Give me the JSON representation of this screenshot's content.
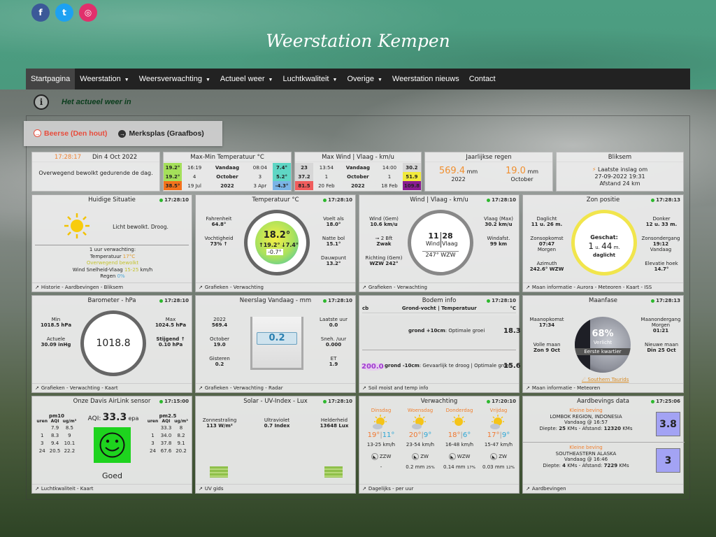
{
  "site_title": "Weerstation Kempen",
  "social": [
    {
      "name": "facebook-icon",
      "glyph": "f",
      "color": "#3b5998"
    },
    {
      "name": "twitter-icon",
      "glyph": "t",
      "color": "#1da1f2"
    },
    {
      "name": "instagram-icon",
      "glyph": "◎",
      "color": "#e1306c"
    }
  ],
  "nav": [
    {
      "label": "Startpagina",
      "caret": false
    },
    {
      "label": "Weerstation",
      "caret": true
    },
    {
      "label": "Weersverwachting",
      "caret": true
    },
    {
      "label": "Actueel weer",
      "caret": true
    },
    {
      "label": "Luchtkwaliteit",
      "caret": true
    },
    {
      "label": "Overige",
      "caret": true
    },
    {
      "label": "Weerstation nieuws",
      "caret": false
    },
    {
      "label": "Contact",
      "caret": false
    }
  ],
  "info_label": "Het actueel weer in",
  "locations": [
    "Beerse (Den hout)",
    "Merksplas (Graafbos)"
  ],
  "current": {
    "time": "17:28:17",
    "date": "Din 4 Oct 2022",
    "text": "Overwegend bewolkt gedurende de dag."
  },
  "maxmin": {
    "title": "Max-Min Temperatuur °C",
    "rows": [
      {
        "a": "19.2°",
        "ac": "#a4e05a",
        "at": "16:19",
        "label": "Vandaag",
        "bt": "08:04",
        "b": "7.4°",
        "bc": "#5fd6c4"
      },
      {
        "a": "19.2°",
        "ac": "#a4e05a",
        "at": "4",
        "label": "October",
        "bt": "3",
        "b": "5.2°",
        "bc": "#5fd6c4"
      },
      {
        "a": "38.5°",
        "ac": "#f4721c",
        "at": "19 Jul",
        "label": "2022",
        "bt": "3 Apr",
        "b": "-4.3°",
        "bc": "#7ab4e6"
      }
    ]
  },
  "maxwind": {
    "title": "Max Wind | Vlaag - km/u",
    "rows": [
      {
        "a": "23",
        "ac": "#d7d7d7",
        "at": "13:54",
        "label": "Vandaag",
        "bt": "14:00",
        "b": "30.2",
        "bc": "#d7d7d7"
      },
      {
        "a": "37.2",
        "ac": "#d7d7d7",
        "at": "1",
        "label": "October",
        "bt": "1",
        "b": "51.9",
        "bc": "#f1ea3c"
      },
      {
        "a": "81.5",
        "ac": "#f05d5d",
        "at": "20 Feb",
        "label": "2022",
        "bt": "18 Feb",
        "b": "109.8",
        "bc": "#8a1b92"
      }
    ]
  },
  "rain_year": {
    "title": "Jaarlijkse regen",
    "v1": "569.4",
    "u1": "mm",
    "l1": "2022",
    "v2": "19.0",
    "u2": "mm",
    "l2": "October"
  },
  "lightning": {
    "title": "Bliksem",
    "l1": "Laatste inslag om",
    "l2": "27-09-2022 19:31",
    "l3": "Afstand 24 km"
  },
  "situatie": {
    "title": "Huidige Situatie",
    "time": "17:28:10",
    "cond": "Licht bewolkt. Droog.",
    "fc1": "1 uur verwachting:",
    "fc2": "Temperatuur",
    "fc2v": "17°C",
    "fc3": "Overwegend bewolkt",
    "fc4": "Wind Snelheid-Vlaag",
    "fc4v": "15-25",
    "fc4u": "km/h",
    "fc5": "Regen",
    "fc5v": "0%",
    "footer": "Historie - Aardbevingen - Bliksem"
  },
  "temp": {
    "title": "Temperatuur °C",
    "time": "17:28:10",
    "fl": "Fahrenheit",
    "flv": "64.8°",
    "vh": "Vochtigheid",
    "vhv": "73% ↑",
    "vo": "Voelt als",
    "vov": "18.0°",
    "nb": "Natte bol",
    "nbv": "15.1°",
    "dp": "Dauwpunt",
    "dpv": "13.2°",
    "main": "18.2°",
    "hi": "19.2°",
    "lo": "7.4°",
    "delta": "-0.7°",
    "footer": "Grafieken - Verwachting"
  },
  "wind": {
    "title": "Wind | Vlaag - km/u",
    "time": "17:28:10",
    "wg": "Wind (Gem)",
    "wgv": "10.6 km/u",
    "bft": "2 Bft",
    "bftl": "Zwak",
    "rg": "Richting (Gem)",
    "rgv": "WZW 242°",
    "vm": "Vlaag (Max)",
    "vmv": "30.2 km/u",
    "wc": "Windafst.",
    "wcv": "99 km",
    "w": "11",
    "wl": "Wind",
    "g": "28",
    "gl": "Vlaag",
    "dir": "247° WZW",
    "footer": "Grafieken - Verwachting"
  },
  "zon": {
    "title": "Zon positie",
    "time": "17:28:13",
    "dl": "Daglicht",
    "dlv": "11 u. 26 m.",
    "dk": "Donker",
    "dkv": "12 u. 33 m.",
    "zo": "Zonsopkomst",
    "zov": "07:47",
    "zom": "Morgen",
    "zn": "Zonsondergang",
    "znv": "19:12",
    "znm": "Vandaag",
    "az": "Azimuth",
    "azv": "242.6° WZW",
    "el": "Elevatie hoek",
    "elv": "14.7°",
    "g": "Geschat:",
    "gv1": "1",
    "gu1": "u.",
    "gv2": "44",
    "gu2": "m.",
    "gl": "daglicht",
    "footer": "Maan informatie - Aurora - Meteoren - Kaart - ISS"
  },
  "baro": {
    "title": "Barometer - hPa",
    "time": "17:28:10",
    "min": "Min",
    "minv": "1018.5 hPa",
    "max": "Max",
    "maxv": "1024.5 hPa",
    "act": "Actuele",
    "actv": "30.09 inHg",
    "trend": "Stijgend ↑",
    "trendv": "0.10 hPa",
    "main": "1018.8",
    "footer": "Grafieken - Verwachting - Kaart"
  },
  "neerslag": {
    "title": "Neerslag Vandaag - mm",
    "time": "17:28:10",
    "y": "2022",
    "yv": "569.4",
    "m": "October",
    "mv": "19.0",
    "g": "Gisteren",
    "gv": "0.2",
    "l": "Laatste uur",
    "lv": "0.0",
    "s": "Sneh. /uur",
    "sv": "0.000",
    "et": "ET",
    "etv": "1.9",
    "main": "0.2",
    "footer": "Grafieken - Verwachting - Radar"
  },
  "bodem": {
    "title": "Bodem info",
    "time": "17:28:10",
    "h1": "cb",
    "h2": "Grond-vocht | Temperatuur",
    "h3": "°C",
    "r1a": "grond +10cm",
    "r1b": ": Optimale groei",
    "r1v": "18.3",
    "r2n": "200.0",
    "r2a": "grond -10cm",
    "r2b": ": Gevaarlijk te droog | Optimale groei",
    "r2v": "15.6",
    "footer": "Soil moist and temp info"
  },
  "maan": {
    "title": "Maanfase",
    "time": "17:28:13",
    "mo": "Maanopkomst",
    "mov": "17:34",
    "mn": "Maanondergang",
    "mnm": "Morgen",
    "mnv": "01:21",
    "vm": "Volle maan",
    "vmv": "Zon 9 Oct",
    "nm": "Nieuwe maan",
    "nmv": "Din 25 Oct",
    "pct": "68%",
    "pl": "Verlicht",
    "phase": "Eerste kwartier",
    "st": "Southern Taurids",
    "footer": "Maan informatie - Meteoren"
  },
  "air": {
    "title": "Onze Davis AirLink sensor",
    "time": "17:15:00",
    "aqi_label": "AQI:",
    "aqi": "33.3",
    "aqi_unit": "epa",
    "pm10": "pm10",
    "pm25": "pm2.5",
    "hu": "uren",
    "ha": "AQI",
    "hug": "ug/m³",
    "rows10": [
      [
        "",
        "7.9",
        "8.5"
      ],
      [
        "1",
        "8.3",
        "9"
      ],
      [
        "3",
        "9.4",
        "10.1"
      ],
      [
        "24",
        "20.5",
        "22.2"
      ]
    ],
    "rows25": [
      [
        "",
        "33.3",
        "8"
      ],
      [
        "1",
        "34.0",
        "8.2"
      ],
      [
        "3",
        "37.8",
        "9.1"
      ],
      [
        "24",
        "67.6",
        "20.2"
      ]
    ],
    "status": "Goed",
    "face_color": "#1ed31e",
    "footer": "Luchtkwaliteit - Kaart"
  },
  "solar": {
    "title": "Solar - UV-Index - Lux",
    "time": "17:28:10",
    "zs": "Zonnestraling",
    "zsv": "113 W/m²",
    "uv": "Ultraviolet",
    "uvv": "0.7 Index",
    "hl": "Helderheid",
    "hlv": "13648 Lux",
    "footer": "UV gids"
  },
  "verwachting": {
    "title": "Verwachting",
    "time": "17:20:10",
    "days": [
      {
        "d": "Dinsdag",
        "hi": "19°",
        "lo": "11°",
        "wind": "13-25 km/h",
        "dir": "ZZW",
        "rain": "-",
        "pct": ""
      },
      {
        "d": "Woensdag",
        "hi": "20°",
        "lo": "9°",
        "wind": "23-54 km/h",
        "dir": "ZW",
        "rain": "0.2 mm",
        "pct": "25%"
      },
      {
        "d": "Donderdag",
        "hi": "18°",
        "lo": "6°",
        "wind": "16-48 km/h",
        "dir": "WZW",
        "rain": "0.14 mm",
        "pct": "17%"
      },
      {
        "d": "Vrijdag",
        "hi": "17°",
        "lo": "9°",
        "wind": "15-47 km/h",
        "dir": "ZW",
        "rain": "0.03 mm",
        "pct": "12%"
      }
    ],
    "footer": "Dagelijks - per uur"
  },
  "aardbeving": {
    "title": "Aardbevings data",
    "time": "17:25:06",
    "items": [
      {
        "k": "Kleine beving",
        "p": "LOMBOK REGION, INDONESIA",
        "t": "Vandaag @ 16:57",
        "dl": "Diepte:",
        "dv": "25",
        "du": "KMs - Afstand:",
        "av": "12320",
        "au": "KMs",
        "m": "3.8"
      },
      {
        "k": "Kleine beving",
        "p": "SOUTHEASTERN ALASKA",
        "t": "Vandaag @ 16:46",
        "dl": "Diepte:",
        "dv": "4",
        "du": "KMs - Afstand:",
        "av": "7229",
        "au": "KMs",
        "m": "3"
      }
    ],
    "footer": "Aardbevingen"
  }
}
